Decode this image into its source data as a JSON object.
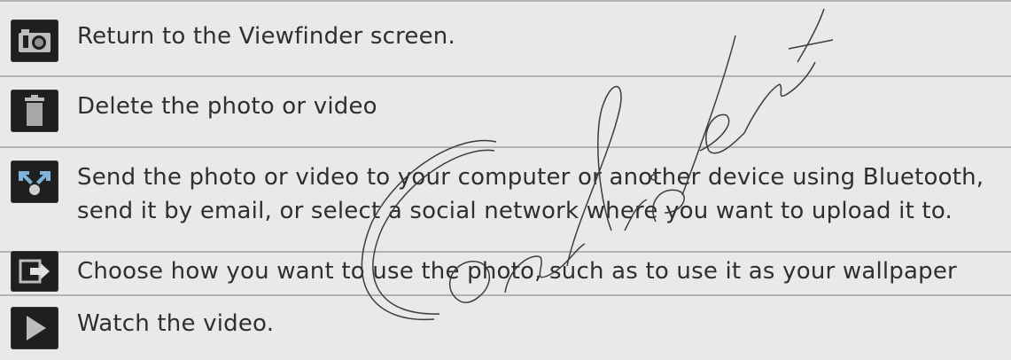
{
  "rows": [
    {
      "icon": "camera-icon",
      "text": "Return to the Viewfinder screen."
    },
    {
      "icon": "trash-icon",
      "text": "Delete the photo or video"
    },
    {
      "icon": "share-icon",
      "text_line1": "Send the photo or video to your computer or another device using Bluetooth,",
      "text_line2": "send it by email, or select a social network where you want to upload it to."
    },
    {
      "icon": "open-with-icon",
      "text": "Choose how you want to use the photo, such as to use it as your wallpaper"
    },
    {
      "icon": "play-icon",
      "text": "Watch the video."
    }
  ],
  "watermark": {
    "text": "Confidential"
  },
  "colors": {
    "background": "#e9e9e9",
    "divider": "#b3b3b3",
    "text": "#2f2f2f",
    "icon_bg": "#1f1f1f"
  }
}
